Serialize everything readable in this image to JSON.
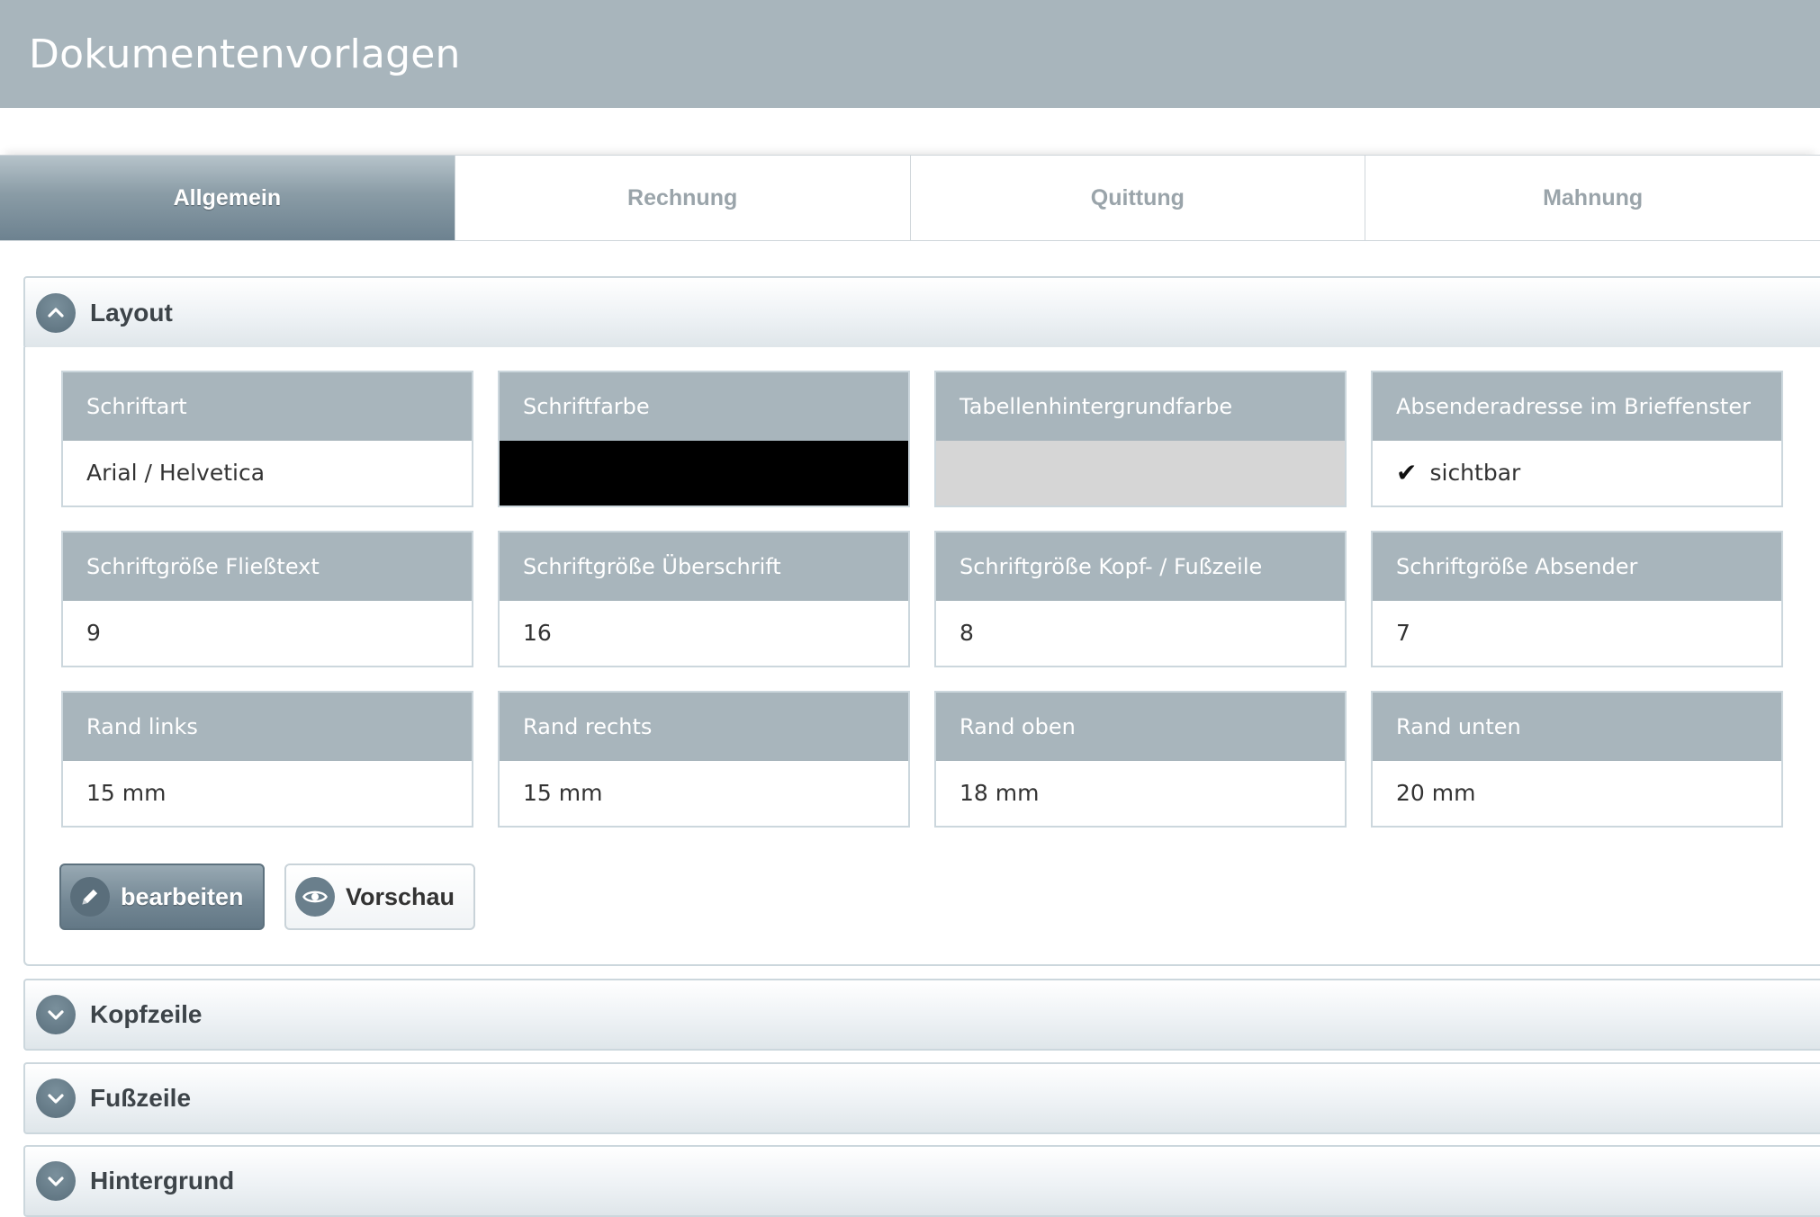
{
  "page": {
    "title": "Dokumentenvorlagen"
  },
  "tabs": [
    {
      "label": "Allgemein",
      "active": true
    },
    {
      "label": "Rechnung",
      "active": false
    },
    {
      "label": "Quittung",
      "active": false
    },
    {
      "label": "Mahnung",
      "active": false
    }
  ],
  "sections": {
    "layout": {
      "label": "Layout",
      "expanded": true,
      "icon": "chevron-up-icon"
    },
    "kopfzeile": {
      "label": "Kopfzeile",
      "expanded": false,
      "icon": "chevron-down-icon"
    },
    "fusszeile": {
      "label": "Fußzeile",
      "expanded": false,
      "icon": "chevron-down-icon"
    },
    "hintergrund": {
      "label": "Hintergrund",
      "expanded": false,
      "icon": "chevron-down-icon"
    }
  },
  "fields": {
    "schriftart": {
      "label": "Schriftart",
      "value": "Arial / Helvetica"
    },
    "schriftfarbe": {
      "label": "Schriftfarbe",
      "color": "#000000"
    },
    "tabellenhintergrundfarbe": {
      "label": "Tabellenhintergrundfarbe",
      "color": "#d6d6d6"
    },
    "absenderadresse": {
      "label": "Absenderadresse im Brieffenster",
      "value": "sichtbar",
      "checked": true
    },
    "schriftgroesse_fliesstext": {
      "label": "Schriftgröße Fließtext",
      "value": "9"
    },
    "schriftgroesse_ueberschrift": {
      "label": "Schriftgröße Überschrift",
      "value": "16"
    },
    "schriftgroesse_kopf_fuss": {
      "label": "Schriftgröße Kopf- / Fußzeile",
      "value": "8"
    },
    "schriftgroesse_absender": {
      "label": "Schriftgröße Absender",
      "value": "7"
    },
    "rand_links": {
      "label": "Rand links",
      "value": "15 mm"
    },
    "rand_rechts": {
      "label": "Rand rechts",
      "value": "15 mm"
    },
    "rand_oben": {
      "label": "Rand oben",
      "value": "18 mm"
    },
    "rand_unten": {
      "label": "Rand unten",
      "value": "20 mm"
    }
  },
  "buttons": {
    "edit": {
      "label": "bearbeiten",
      "icon": "pencil-icon"
    },
    "preview": {
      "label": "Vorschau",
      "icon": "eye-icon"
    }
  },
  "colors": {
    "header_bg": "#a8b5bc",
    "active_tab": "#6d8290",
    "accent": "#5a6f7c"
  }
}
